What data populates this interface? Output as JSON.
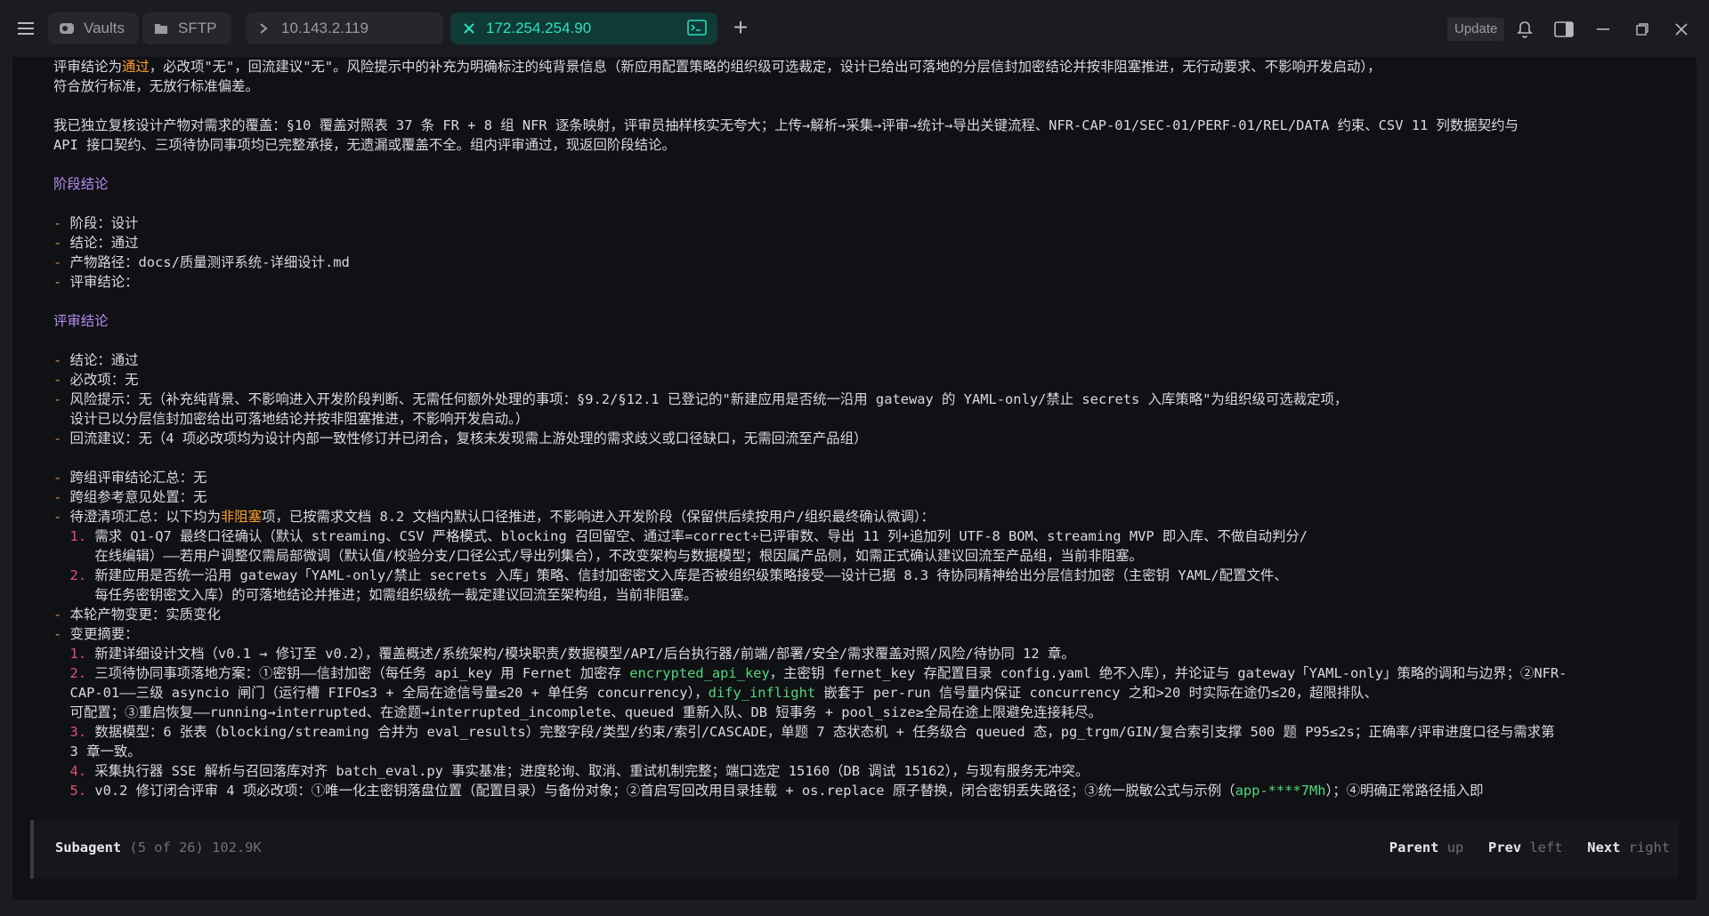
{
  "titlebar": {
    "tabs": [
      {
        "label": "Vaults",
        "icon": "vault-icon"
      },
      {
        "label": "SFTP",
        "icon": "folder-icon"
      },
      {
        "label": "10.143.2.119",
        "icon": "terminal-icon"
      },
      {
        "label": "172.254.254.90",
        "icon": "terminal-icon"
      }
    ],
    "new_tab": "+",
    "update_label": "Update"
  },
  "content": {
    "lines": [
      "评审结论为通过，必改项\"无\"，回流建议\"无\"。风险提示中的补充为明确标注的纯背景信息（新应用配置策略的组织级可选裁定，设计已给出可落地的分层信封加密结论并按非阻塞推进，无行动要求、不影响开发启动），",
      "符合放行标准，无放行标准偏差。",
      "",
      "我已独立复核设计产物对需求的覆盖：§10 覆盖对照表 37 条 FR + 8 组 NFR 逐条映射，评审员抽样核实无夸大；上传→解析→采集→评审→统计→导出关键流程、NFR-CAP-01/SEC-01/PERF-01/REL/DATA 约束、CSV 11 列数据契约与",
      "API 接口契约、三项待协同事项均已完整承接，无遗漏或覆盖不全。组内评审通过，现返回阶段结论。",
      "",
      "阶段结论",
      "",
      "- 阶段：设计",
      "- 结论：通过",
      "- 产物路径：docs/质量测评系统-详细设计.md",
      "- 评审结论：",
      "",
      "评审结论",
      "",
      "- 结论：通过",
      "- 必改项：无",
      "- 风险提示：无（补充纯背景、不影响进入开发阶段判断、无需任何额外处理的事项：§9.2/§12.1 已登记的\"新建应用是否统一沿用 gateway 的 YAML-only/禁止 secrets 入库策略\"为组织级可选裁定项，",
      "  设计已以分层信封加密给出可落地结论并按非阻塞推进，不影响开发启动。）",
      "- 回流建议：无（4 项必改项均为设计内部一致性修订并已闭合，复核未发现需上游处理的需求歧义或口径缺口，无需回流至产品组）",
      "",
      "- 跨组评审结论汇总：无",
      "- 跨组参考意见处置：无",
      "- 待澄清项汇总：以下均为非阻塞项，已按需求文档 8.2 文档内默认口径推进，不影响进入开发阶段（保留供后续按用户/组织最终确认微调）：",
      "  1. 需求 Q1-Q7 最终口径确认（默认 streaming、CSV 严格模式、blocking 召回留空、通过率=correct÷已评审数、导出 11 列+追加列 UTF-8 BOM、streaming MVP 即入库、不做自动判分/",
      "     在线编辑）——若用户调整仅需局部微调（默认值/校验分支/口径公式/导出列集合），不改变架构与数据模型；根因属产品侧，如需正式确认建议回流至产品组，当前非阻塞。",
      "  2. 新建应用是否统一沿用 gateway「YAML-only/禁止 secrets 入库」策略、信封加密密文入库是否被组织级策略接受——设计已据 8.3 待协同精神给出分层信封加密（主密钥 YAML/配置文件、",
      "     每任务密钥密文入库）的可落地结论并推进；如需组织级统一裁定建议回流至架构组，当前非阻塞。",
      "- 本轮产物变更：实质变化",
      "- 变更摘要：",
      "  1. 新建详细设计文档（v0.1 → 修订至 v0.2），覆盖概述/系统架构/模块职责/数据模型/API/后台执行器/前端/部署/安全/需求覆盖对照/风险/待协同 12 章。",
      "  2. 三项待协同事项落地方案：①密钥——信封加密（每任务 api_key 用 Fernet 加密存 encrypted_api_key，主密钥 fernet_key 存配置目录 config.yaml 绝不入库），并论证与 gateway「YAML-only」策略的调和与边界；②NFR-",
      "  CAP-01——三级 asyncio 闸门（运行槽 FIFO≤3 + 全局在途信号量≤20 + 单任务 concurrency），dify_inflight 嵌套于 per-run 信号量内保证 concurrency 之和>20 时实际在途仍≤20，超限排队、",
      "  可配置；③重启恢复——running→interrupted、在途题→interrupted_incomplete、queued 重新入队、DB 短事务 + pool_size≥全局在途上限避免连接耗尽。",
      "  3. 数据模型：6 张表（blocking/streaming 合并为 eval_results）完整字段/类型/约束/索引/CASCADE，单题 7 态状态机 + 任务级合 queued 态，pg_trgm/GIN/复合索引支撑 500 题 P95≤2s；正确率/评审进度口径与需求第",
      "  3 章一致。",
      "  4. 采集执行器 SSE 解析与召回落库对齐 batch_eval.py 事实基准；进度轮询、取消、重试机制完整；端口选定 15160（DB 调试 15162），与现有服务无冲突。",
      "  5. v0.2 修订闭合评审 4 项必改项：①唯一化主密钥落盘位置（配置目录）与备份对象；②首启写回改用目录挂载 + os.replace 原子替换，闭合密钥丢失路径；③统一脱敏公式与示例（app-****7Mh）；④明确正常路径插入即"
    ]
  },
  "footer": {
    "title": "Subagent",
    "position": "(5 of 26) 102.9K",
    "nav": [
      {
        "key": "Parent",
        "hint": "up"
      },
      {
        "key": "Prev",
        "hint": "left"
      },
      {
        "key": "Next",
        "hint": "right"
      }
    ]
  },
  "colors": {
    "background": "#101114",
    "active_tab": "#0f3a35",
    "accent": "#2fe0c0",
    "heading": "#b48cf0",
    "highlight": "#ff9f2e"
  }
}
